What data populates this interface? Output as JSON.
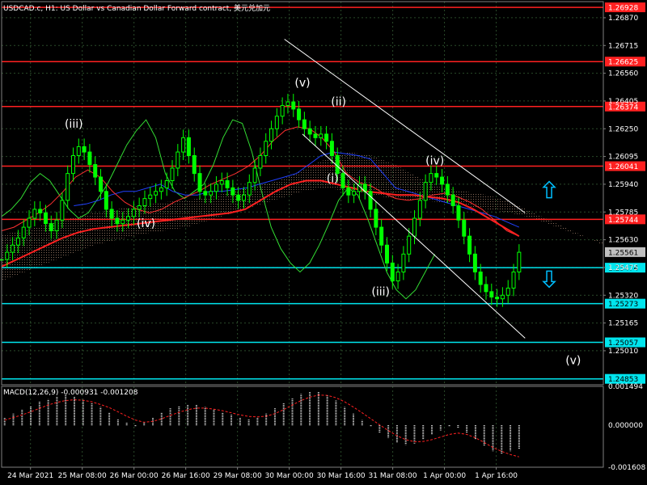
{
  "window": {
    "title": "USDCAD.c, H1:  US Dollar vs Canadian Dollar Forward contract, 美元兑加元"
  },
  "colors": {
    "background": "#000000",
    "grid": "#2a4a2a",
    "candle": "#00ff00",
    "chikou": "#33dd33",
    "resistance": "#ff2020",
    "support": "#00e5ee",
    "tenkan": "#ff3030",
    "kijun": "#2040ff",
    "ma": "#ff2020",
    "cloud": "#f0c0a0",
    "channel": "#ffffff",
    "arrow": "#00bfff",
    "axis_text": "#ffffff",
    "macd_hist": "#e0e0e0",
    "macd_signal": "#ff2020"
  },
  "chart_data": {
    "type": "line",
    "symbol": "USDCAD.c",
    "timeframe": "H1",
    "ylim": [
      1.2482,
      1.2696
    ],
    "price_axis_labels": [
      "1.26870",
      "1.26715",
      "1.26560",
      "1.26405",
      "1.26250",
      "1.26095",
      "1.25940",
      "1.25785",
      "1.25630",
      "1.25475",
      "1.25320",
      "1.25165",
      "1.25010"
    ],
    "time_axis_labels": [
      "24 Mar 2021",
      "25 Mar 08:00",
      "26 Mar 00:00",
      "26 Mar 16:00",
      "29 Mar 08:00",
      "30 Mar 00:00",
      "30 Mar 16:00",
      "31 Mar 08:00",
      "1 Apr 00:00",
      "1 Apr 16:00"
    ],
    "current_price": "1.25561",
    "current_price_value": 1.25561,
    "resistance_levels": [
      {
        "label": "1.26928",
        "value": 1.26928
      },
      {
        "label": "1.26625",
        "value": 1.26625
      },
      {
        "label": "1.26374",
        "value": 1.26374
      },
      {
        "label": "1.26041",
        "value": 1.26041
      },
      {
        "label": "1.25744",
        "value": 1.25744
      }
    ],
    "support_levels": [
      {
        "label": "1.25474",
        "value": 1.25474
      },
      {
        "label": "1.25273",
        "value": 1.25273
      },
      {
        "label": "1.25057",
        "value": 1.25057
      },
      {
        "label": "1.24853",
        "value": 1.24853
      }
    ],
    "close_series": [
      1.2552,
      1.2556,
      1.256,
      1.2564,
      1.257,
      1.2575,
      1.258,
      1.2578,
      1.2572,
      1.2568,
      1.2574,
      1.2585,
      1.26,
      1.261,
      1.2615,
      1.2612,
      1.2605,
      1.2598,
      1.259,
      1.258,
      1.2575,
      1.2572,
      1.2574,
      1.2576,
      1.258,
      1.2582,
      1.2586,
      1.2588,
      1.259,
      1.2592,
      1.2596,
      1.2603,
      1.2612,
      1.262,
      1.261,
      1.26,
      1.259,
      1.2588,
      1.259,
      1.2594,
      1.2596,
      1.2592,
      1.2588,
      1.2585,
      1.2588,
      1.2595,
      1.2603,
      1.261,
      1.2618,
      1.2625,
      1.2632,
      1.2638,
      1.264,
      1.2636,
      1.263,
      1.2625,
      1.2622,
      1.262,
      1.2622,
      1.2618,
      1.261,
      1.26,
      1.2592,
      1.2588,
      1.259,
      1.2594,
      1.259,
      1.258,
      1.257,
      1.256,
      1.255,
      1.254,
      1.2545,
      1.2555,
      1.2565,
      1.2575,
      1.2585,
      1.2595,
      1.26,
      1.2598,
      1.2594,
      1.2588,
      1.2582,
      1.2574,
      1.2565,
      1.2555,
      1.2545,
      1.2538,
      1.2534,
      1.2531,
      1.253,
      1.2532,
      1.2536,
      1.2545,
      1.2556
    ],
    "tenkan_series": [
      1.2568,
      1.257,
      1.2574,
      1.2578,
      1.2583,
      1.259,
      1.2598,
      1.2602,
      1.2598,
      1.259,
      1.2584,
      1.258,
      1.2578,
      1.258,
      1.2584,
      1.2587,
      1.259,
      1.2594,
      1.2597,
      1.26,
      1.2604,
      1.261,
      1.2618,
      1.2624,
      1.2626,
      1.2625,
      1.262,
      1.2612,
      1.26,
      1.2595,
      1.2593,
      1.2589,
      1.2586,
      1.2585,
      1.2586,
      1.2588,
      1.2589,
      1.2587,
      1.2584,
      1.258,
      1.2574,
      1.2568,
      1.2565
    ],
    "kijun_series": [
      1.2582,
      1.2583,
      1.2585,
      1.2588,
      1.259,
      1.259,
      1.2592,
      1.2594,
      1.259,
      1.2588,
      1.2588,
      1.259,
      1.259,
      1.2591,
      1.2592,
      1.2594,
      1.2596,
      1.2598,
      1.26,
      1.2605,
      1.261,
      1.2612,
      1.2611,
      1.261,
      1.2608,
      1.26,
      1.2592,
      1.259,
      1.2588,
      1.2586,
      1.2584,
      1.2582,
      1.258,
      1.2578,
      1.2576,
      1.2573,
      1.257
    ],
    "ma_series": [
      1.2548,
      1.2552,
      1.2556,
      1.256,
      1.2564,
      1.2567,
      1.2569,
      1.257,
      1.2571,
      1.2572,
      1.2573,
      1.2574,
      1.2575,
      1.2576,
      1.2577,
      1.2578,
      1.258,
      1.2585,
      1.259,
      1.2594,
      1.2596,
      1.2596,
      1.2594,
      1.2592,
      1.259,
      1.2589,
      1.2588,
      1.2588,
      1.2587,
      1.2586,
      1.2584,
      1.258,
      1.2575,
      1.257,
      1.2565
    ],
    "cloud_top_series": [
      1.2566,
      1.2568,
      1.2572,
      1.2575,
      1.2578,
      1.258,
      1.2582,
      1.2584,
      1.2585,
      1.2587,
      1.259,
      1.2593,
      1.2596,
      1.2602,
      1.2608,
      1.2612,
      1.261,
      1.2605,
      1.2598,
      1.2592,
      1.259,
      1.2588,
      1.2584,
      1.2578,
      1.2572,
      1.2566,
      1.256
    ],
    "cloud_bottom_series": [
      1.254,
      1.2545,
      1.255,
      1.2555,
      1.256,
      1.2563,
      1.2566,
      1.2568,
      1.257,
      1.2574,
      1.2578,
      1.2582,
      1.2586,
      1.259,
      1.2592,
      1.259,
      1.2588,
      1.2586,
      1.2585,
      1.2584,
      1.2582,
      1.258,
      1.2578,
      1.2575,
      1.257,
      1.2565,
      1.2562
    ],
    "chikou_series": [
      1.2576,
      1.258,
      1.2586,
      1.2595,
      1.26,
      1.2596,
      1.2588,
      1.258,
      1.2575,
      1.2578,
      1.2586,
      1.2594,
      1.2605,
      1.2616,
      1.2624,
      1.263,
      1.262,
      1.26,
      1.259,
      1.2586,
      1.259,
      1.2594,
      1.2605,
      1.262,
      1.263,
      1.2628,
      1.2612,
      1.259,
      1.257,
      1.2558,
      1.255,
      1.2545,
      1.255,
      1.256,
      1.2572,
      1.2585,
      1.2592,
      1.2588,
      1.2575,
      1.256,
      1.2545,
      1.2535,
      1.253,
      1.2535,
      1.2545,
      1.2555
    ],
    "channel_upper": {
      "t0": 0.47,
      "t1": 0.87,
      "p0": 1.2675,
      "p1": 1.2578
    },
    "channel_lower": {
      "t0": 0.5,
      "t1": 0.87,
      "p0": 1.2622,
      "p1": 1.2508
    },
    "wave_labels": [
      {
        "text": "(iii)",
        "t": 0.12,
        "p": 1.26255
      },
      {
        "text": "(iv)",
        "t": 0.24,
        "p": 1.257
      },
      {
        "text": "(v)",
        "t": 0.5,
        "p": 1.26485
      },
      {
        "text": "(i)",
        "t": 0.55,
        "p": 1.2595
      },
      {
        "text": "(ii)",
        "t": 0.56,
        "p": 1.2638
      },
      {
        "text": "(iii)",
        "t": 0.63,
        "p": 1.2532
      },
      {
        "text": "(iv)",
        "t": 0.72,
        "p": 1.2605
      },
      {
        "text": "(v)",
        "t": 0.95,
        "p": 1.24935
      }
    ],
    "arrows": [
      {
        "direction": "up",
        "t": 0.91,
        "p": 1.2591
      },
      {
        "direction": "down",
        "t": 0.91,
        "p": 1.2541
      }
    ]
  },
  "macd": {
    "title": "MACD(12,26,9) -0.000931 -0.001208",
    "axis_labels": [
      "0.001494",
      "0.000000",
      "-0.001608"
    ],
    "ylim": [
      -0.001608,
      0.001494
    ],
    "histogram": [
      0.0003,
      0.00045,
      0.0006,
      0.00075,
      0.0009,
      0.001,
      0.0011,
      0.00115,
      0.0011,
      0.001,
      0.00085,
      0.0007,
      0.0005,
      0.00025,
      0.0001,
      -5e-05,
      0.0001,
      0.0003,
      0.0005,
      0.00065,
      0.00075,
      0.0008,
      0.00078,
      0.0007,
      0.0006,
      0.0005,
      0.0004,
      0.0003,
      0.00025,
      0.0003,
      0.00045,
      0.00065,
      0.00085,
      0.00105,
      0.0012,
      0.0013,
      0.00128,
      0.00115,
      0.00095,
      0.0007,
      0.00045,
      0.0002,
      -5e-05,
      -0.0003,
      -0.0005,
      -0.00065,
      -0.00075,
      -0.0007,
      -0.00055,
      -0.00035,
      -0.0002,
      -5e-05,
      -0.0001,
      -0.0003,
      -0.00055,
      -0.0008,
      -0.001,
      -0.0011,
      -0.001,
      -0.00093
    ],
    "signal": [
      0.0002,
      0.0003,
      0.0004,
      0.00052,
      0.00065,
      0.00078,
      0.00088,
      0.00095,
      0.00098,
      0.00096,
      0.0009,
      0.0008,
      0.00068,
      0.00052,
      0.00035,
      0.0002,
      0.00012,
      0.00015,
      0.00025,
      0.00038,
      0.0005,
      0.0006,
      0.00066,
      0.00066,
      0.00062,
      0.00056,
      0.00048,
      0.0004,
      0.00034,
      0.00032,
      0.00035,
      0.00045,
      0.0006,
      0.00078,
      0.00095,
      0.00108,
      0.00116,
      0.00115,
      0.00106,
      0.0009,
      0.0007,
      0.00048,
      0.00025,
      2e-05,
      -0.0002,
      -0.0004,
      -0.00055,
      -0.00063,
      -0.00062,
      -0.00055,
      -0.00045,
      -0.00035,
      -0.0003,
      -0.00035,
      -0.00048,
      -0.00066,
      -0.00085,
      -0.001,
      -0.00112,
      -0.00121
    ]
  }
}
